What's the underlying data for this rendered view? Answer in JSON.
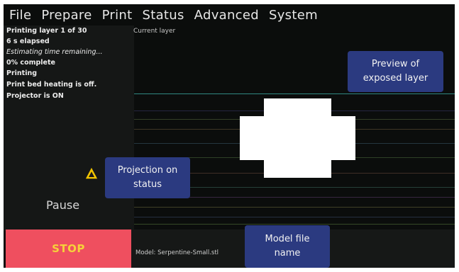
{
  "menu": {
    "items": [
      "File",
      "Prepare",
      "Print",
      "Status",
      "Advanced",
      "System"
    ]
  },
  "status": {
    "layer": "Printing layer 1 of 30",
    "elapsed": "6 s elapsed",
    "remaining": "Estimating time remaining...",
    "complete": "0% complete",
    "state": "Printing",
    "bed": "Print bed heating is off.",
    "projector": "Projector is ON"
  },
  "preview": {
    "current_layer_label": "Current layer"
  },
  "callouts": {
    "preview": "Preview of exposed layer",
    "projection": "Projection on status",
    "model": "Model file name"
  },
  "controls": {
    "pause_label": "Pause",
    "stop_label": "STOP"
  },
  "model": {
    "label": "Model: Serpentine-Small.stl"
  },
  "colors": {
    "screen_bg": "#0b0d0c",
    "stop_button": "#ef4f5f",
    "stop_text": "#f6d13a",
    "callout_bg": "#2b3a80",
    "warning": "#f2c500"
  }
}
